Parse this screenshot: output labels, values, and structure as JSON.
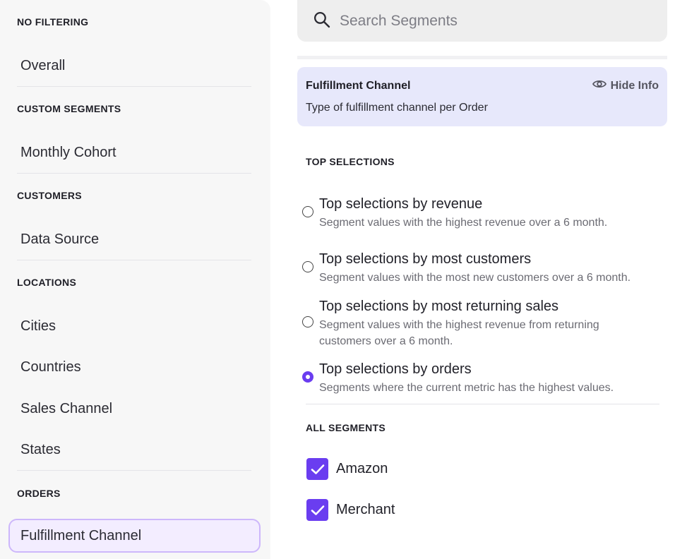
{
  "sidebar": {
    "groups": [
      {
        "heading": "NO FILTERING",
        "items": [
          "Overall"
        ]
      },
      {
        "heading": "CUSTOM SEGMENTS",
        "items": [
          "Monthly Cohort"
        ]
      },
      {
        "heading": "CUSTOMERS",
        "items": [
          "Data Source"
        ]
      },
      {
        "heading": "LOCATIONS",
        "items": [
          "Cities",
          "Countries",
          "Sales Channel",
          "States"
        ]
      },
      {
        "heading": "ORDERS",
        "items": [
          "Fulfillment Channel"
        ]
      }
    ],
    "active_item": "Fulfillment Channel"
  },
  "search": {
    "placeholder": "Search Segments",
    "value": ""
  },
  "info": {
    "title": "Fulfillment Channel",
    "description": "Type of fulfillment channel per Order",
    "toggle_label": "Hide Info"
  },
  "top_selections": {
    "heading": "TOP SELECTIONS",
    "options": [
      {
        "title": "Top selections by revenue",
        "description": "Segment values with the highest revenue over a 6 month.",
        "selected": false
      },
      {
        "title": "Top selections by most customers",
        "description": "Segment values with the most new customers over a 6 month.",
        "selected": false
      },
      {
        "title": "Top selections by most returning sales",
        "description": "Segment values with the highest revenue from returning customers over a 6 month.",
        "selected": false
      },
      {
        "title": "Top selections by orders",
        "description": "Segments where the current metric has the highest values.",
        "selected": true
      }
    ]
  },
  "all_segments": {
    "heading": "ALL SEGMENTS",
    "items": [
      {
        "label": "Amazon",
        "checked": true
      },
      {
        "label": "Merchant",
        "checked": true
      }
    ]
  },
  "colors": {
    "accent": "#6a3df0",
    "active_item_bg": "#f3edff",
    "active_item_border": "#cdb7fb",
    "info_bg": "#e7e8fb",
    "sidebar_bg": "#f7f7f7"
  }
}
